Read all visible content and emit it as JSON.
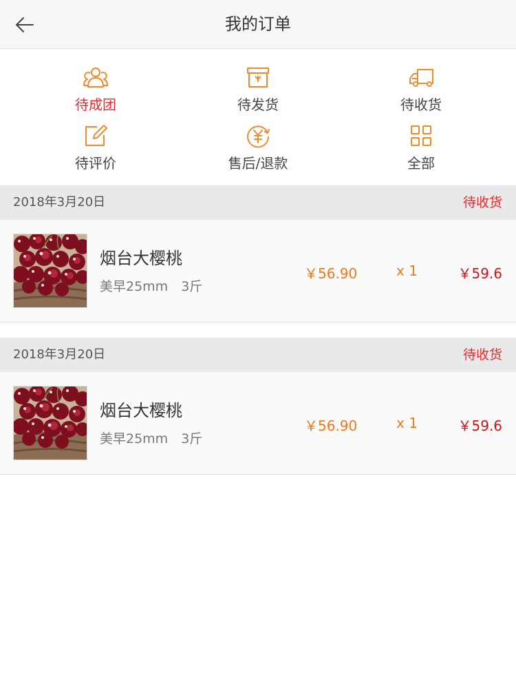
{
  "header": {
    "title": "我的订单",
    "back_icon": "back-arrow-icon"
  },
  "colors": {
    "accent_orange": "#f08a2c",
    "active_red": "#e8292f",
    "price_orange": "#f07a1a",
    "total_red": "#d0121b"
  },
  "status_tabs": [
    {
      "label": "待成团",
      "icon": "group-icon",
      "active": true
    },
    {
      "label": "待发货",
      "icon": "box-icon",
      "active": false
    },
    {
      "label": "待收货",
      "icon": "truck-icon",
      "active": false
    },
    {
      "label": "待评价",
      "icon": "edit-icon",
      "active": false
    },
    {
      "label": "售后/退款",
      "icon": "refund-icon",
      "active": false
    },
    {
      "label": "全部",
      "icon": "grid-icon",
      "active": false
    }
  ],
  "orders": [
    {
      "date": "2018年3月20日",
      "status": "待收货",
      "product_name": "烟台大樱桃",
      "spec": "美早25mm　3斤",
      "unit_price": "￥56.90",
      "quantity": "x 1",
      "total": "￥59.6",
      "image": "cherries-image"
    },
    {
      "date": "2018年3月20日",
      "status": "待收货",
      "product_name": "烟台大樱桃",
      "spec": "美早25mm　3斤",
      "unit_price": "￥56.90",
      "quantity": "x 1",
      "total": "￥59.6",
      "image": "cherries-image"
    }
  ]
}
